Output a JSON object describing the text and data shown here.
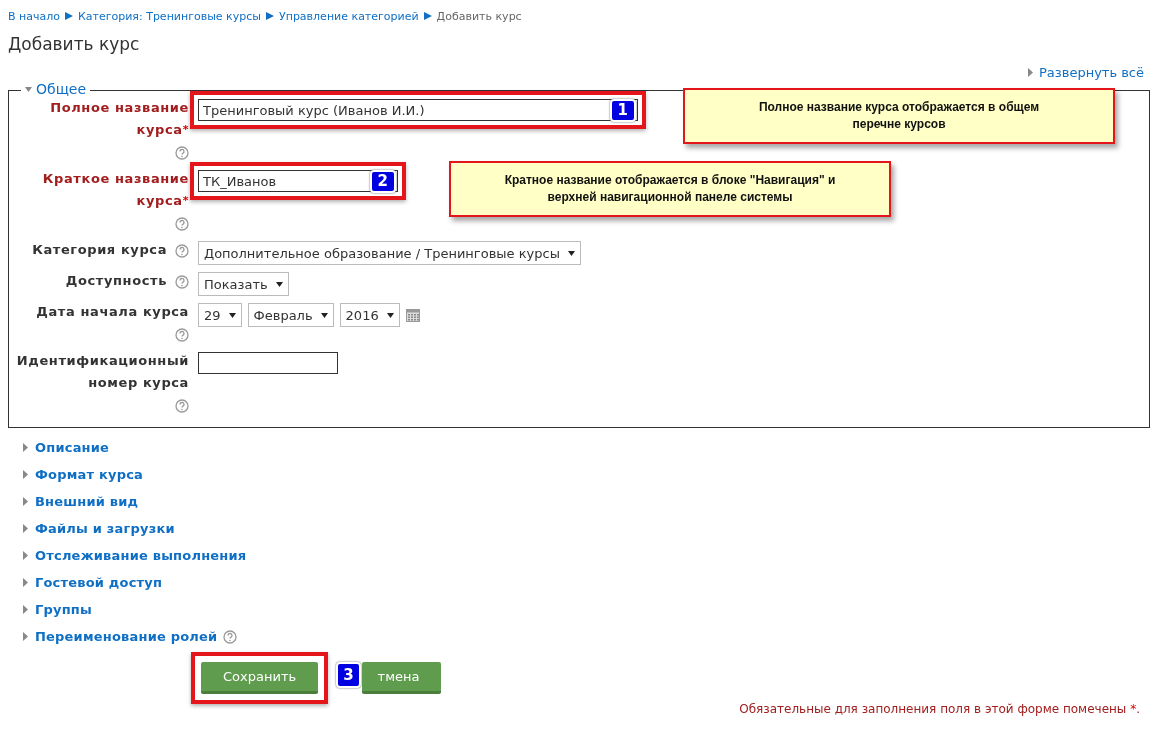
{
  "breadcrumb": [
    {
      "label": "В начало"
    },
    {
      "label": "Категория: Тренинговые курсы"
    },
    {
      "label": "Управление категорией"
    },
    {
      "label": "Добавить курс"
    }
  ],
  "title": "Добавить курс",
  "expand_all": "Развернуть всё",
  "general": {
    "legend": "Общее",
    "expanded": true,
    "fields": [
      {
        "kind": "text",
        "label": "Полное название курса",
        "required": true,
        "mark": "*",
        "help": true,
        "value": "Тренинговый курс (Иванов И.И.)",
        "badge": "1",
        "wide": true
      },
      {
        "kind": "text",
        "label": "Краткое название курса",
        "required": true,
        "mark": "*",
        "help": true,
        "value": "ТК_Иванов",
        "badge": "2",
        "wide": false
      },
      {
        "kind": "select",
        "label": "Категория курса",
        "required": false,
        "help": true,
        "options": [
          "Дополнительное образование / Тренинговые курсы"
        ]
      },
      {
        "kind": "select",
        "label": "Доступность",
        "required": false,
        "help": true,
        "options": [
          "Показать"
        ]
      },
      {
        "kind": "date",
        "label": "Дата начала курса",
        "required": false,
        "help": true,
        "options": [
          "29",
          "Февраль",
          "2016"
        ]
      },
      {
        "kind": "text",
        "label": "Идентификационный номер курса",
        "required": false,
        "help": true,
        "wide": false
      }
    ]
  },
  "callouts": [
    {
      "text": "Полное название курса отображается в общем перечне курсов"
    },
    {
      "text": "Кратное название отображается в блоке \"Навигация\" и верхней навигационной панеле системы"
    }
  ],
  "sections": [
    {
      "label": "Описание",
      "expanded": false,
      "help": false
    },
    {
      "label": "Формат курса",
      "expanded": false,
      "help": false
    },
    {
      "label": "Внешний вид",
      "expanded": false,
      "help": false
    },
    {
      "label": "Файлы и загрузки",
      "expanded": false,
      "help": false
    },
    {
      "label": "Отслеживание выполнения",
      "expanded": false,
      "help": false
    },
    {
      "label": "Гостевой доступ",
      "expanded": false,
      "help": false
    },
    {
      "label": "Группы",
      "expanded": false,
      "help": false
    },
    {
      "label": "Переименование ролей",
      "expanded": false,
      "help": true
    }
  ],
  "buttons": [
    {
      "label": "Сохранить",
      "highlighted": true
    },
    {
      "label": "тмена",
      "highlighted": false,
      "badge": "3"
    }
  ],
  "note": {
    "text": "Обязательные для заполнения поля в этой форме помечены",
    "mark": "*",
    "end": "."
  }
}
